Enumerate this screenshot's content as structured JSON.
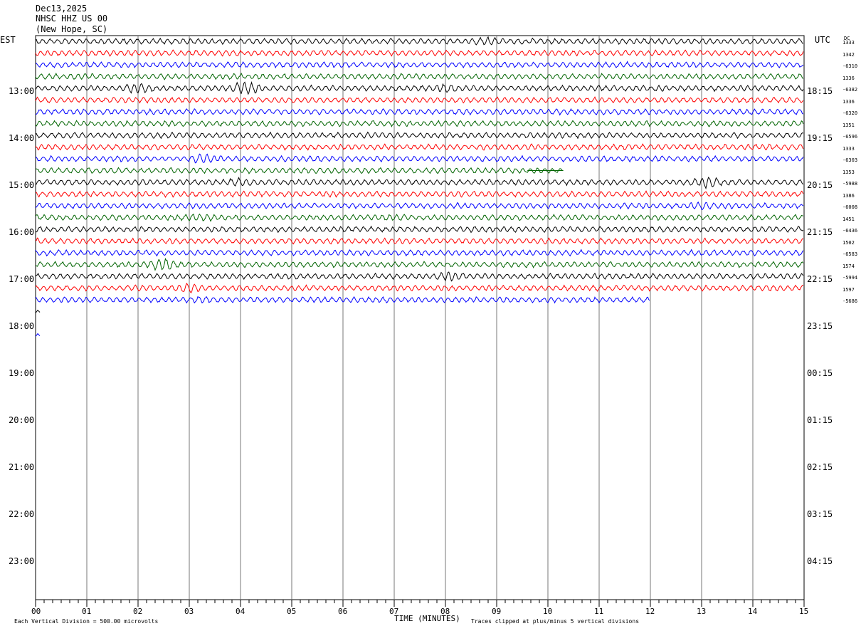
{
  "header": {
    "date": "Dec13,2025",
    "station": "NHSC HHZ US 00",
    "location": "(New Hope, SC)"
  },
  "chart_data": {
    "type": "line",
    "title": "",
    "xlabel": "TIME (MINUTES)",
    "left_axis_label": "EST",
    "right_axis_label": "UTC",
    "dc_label": "DC",
    "xlim": [
      0,
      15
    ],
    "x_ticks": [
      "00",
      "01",
      "02",
      "03",
      "04",
      "05",
      "06",
      "07",
      "08",
      "09",
      "10",
      "11",
      "12",
      "13",
      "14",
      "15"
    ],
    "left_hour_labels": [
      "13:00",
      "14:00",
      "15:00",
      "16:00",
      "17:00",
      "18:00",
      "19:00",
      "20:00",
      "21:00",
      "22:00",
      "23:00"
    ],
    "right_hour_labels": [
      "18:15",
      "19:15",
      "20:15",
      "21:15",
      "22:15",
      "23:15",
      "00:15",
      "01:15",
      "02:15",
      "03:15",
      "04:15"
    ],
    "trace_colors": [
      "#000000",
      "#ff0000",
      "#0000ff",
      "#006400"
    ],
    "dc_offsets": [
      "1333",
      "1342",
      "-6310",
      "1336",
      "-6382",
      "1336",
      "-6320",
      "1351",
      "-6596",
      "1333",
      "-6303",
      "1353",
      "-5988",
      "1386",
      "-6008",
      "1451",
      "-6436",
      "1502",
      "-6583",
      "1574",
      "-5994",
      "1597",
      "-5686"
    ],
    "trace_end_minutes": [
      15,
      15,
      15,
      15,
      15,
      15,
      15,
      15,
      15,
      15,
      15,
      10.3,
      15,
      15,
      15,
      15,
      15,
      15,
      15,
      15,
      15,
      15,
      12
    ],
    "gaps": [
      {
        "trace": 11,
        "from": 10.3,
        "to": 11.0
      },
      {
        "trace": 11,
        "from": 11.8,
        "to": 13.0
      }
    ],
    "footer_scale": "Each Vertical Division =  500.00 microvolts",
    "footer_clip": "Traces clipped at plus/minus 5 vertical divisions"
  }
}
